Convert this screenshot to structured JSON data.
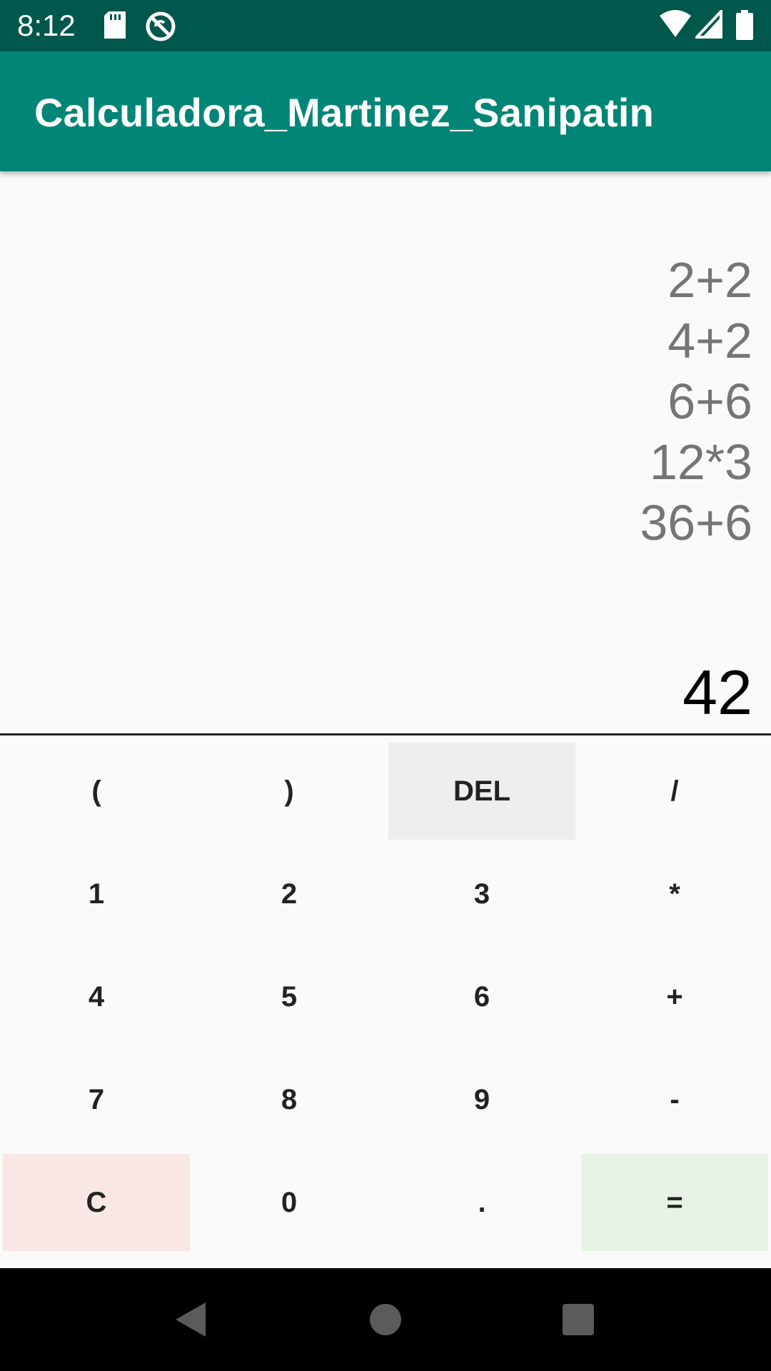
{
  "status_bar": {
    "time": "8:12",
    "left_icons": [
      "sd-card-icon",
      "no-sync-icon"
    ],
    "right_icons": [
      "wifi-icon",
      "cellular-signal-icon",
      "battery-icon"
    ]
  },
  "app_bar": {
    "title": "Calculadora_Martinez_Sanipatin",
    "color": "#008577"
  },
  "display": {
    "history": [
      "2+2",
      "4+2",
      "6+6",
      "12*3",
      "36+6"
    ],
    "result": "42"
  },
  "keypad": {
    "rows": [
      [
        "(",
        ")",
        "DEL",
        "/"
      ],
      [
        "1",
        "2",
        "3",
        "*"
      ],
      [
        "4",
        "5",
        "6",
        "+"
      ],
      [
        "7",
        "8",
        "9",
        "-"
      ],
      [
        "C",
        "0",
        ".",
        "="
      ]
    ],
    "colors": {
      "del": "#eeeeee",
      "clear": "#f8e7e5",
      "equals": "#e7f4e5"
    }
  },
  "nav_bar": {
    "buttons": [
      "back-icon",
      "home-icon",
      "recents-icon"
    ]
  }
}
